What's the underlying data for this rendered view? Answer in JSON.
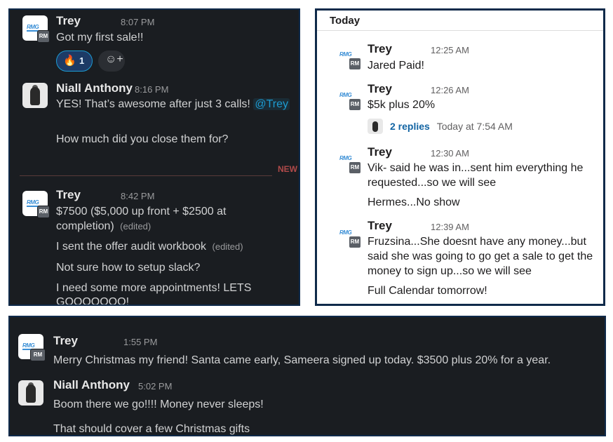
{
  "panel_top_left": {
    "messages": [
      {
        "author": "Trey",
        "avatar": "rmg-logo",
        "badge": "RM",
        "time": "8:07 PM",
        "lines": [
          "Got my first sale!!"
        ],
        "reactions": [
          {
            "icon": "fire-emoji",
            "glyph": "🔥",
            "count": "1"
          },
          {
            "icon": "add-reaction-icon",
            "glyph": "☺+"
          }
        ]
      },
      {
        "author": "Niall Anthony",
        "avatar": "photo",
        "time": "8:16 PM",
        "line1": "YES! That’s awesome after just 3 calls!",
        "mention": "@Trey",
        "line2": "How much did you close them for?"
      },
      {
        "author": "Trey",
        "avatar": "rmg-logo",
        "badge": "RM",
        "time": "8:42 PM",
        "line1": "$7500 ($5,000 up front + $2500 at",
        "line2": "completion)",
        "edited": "(edited)",
        "line3": "I sent the offer audit workbook",
        "line4": "Not sure how to setup slack?",
        "line5": "I need some more appointments! LETS",
        "line6": "GOOOOOOO!"
      }
    ],
    "new_label": "NEW"
  },
  "panel_top_right": {
    "header": "Today",
    "messages": [
      {
        "author": "Trey",
        "badge": "RM",
        "time": "12:25 AM",
        "lines": [
          "Jared Paid!"
        ]
      },
      {
        "author": "Trey",
        "badge": "RM",
        "time": "12:26 AM",
        "lines": [
          "$5k plus 20%"
        ],
        "thread": {
          "replies": "2 replies",
          "last": "Today at 7:54 AM"
        }
      },
      {
        "author": "Trey",
        "badge": "RM",
        "time": "12:30 AM",
        "lines": [
          "Vik- said he was in...sent him everything he",
          "requested...so we will see",
          "Hermes...No show"
        ]
      },
      {
        "author": "Trey",
        "badge": "RM",
        "time": "12:39 AM",
        "lines": [
          "Fruzsina...She doesnt have any money...but",
          "said she was going to go get a sale to get the",
          "money to sign up...so we will see",
          "Full Calendar tomorrow!"
        ]
      }
    ]
  },
  "panel_bottom": {
    "messages": [
      {
        "author": "Trey",
        "badge": "RM",
        "time": "1:55 PM",
        "lines": [
          "Merry Christmas my friend! Santa came early, Sameera signed up today. $3500 plus 20% for a year."
        ]
      },
      {
        "author": "Niall Anthony",
        "time": "5:02 PM",
        "lines": [
          "Boom there we go!!!! Money never sleeps!",
          "That should cover a few Christmas gifts"
        ]
      }
    ]
  },
  "logo_text": "RMG",
  "colors": {
    "dark_bg": "#1a1d21",
    "border": "#0f2a4a",
    "mention": "#1d9bd1",
    "reaction_bg": "#1d3b66",
    "link": "#1264a3"
  }
}
